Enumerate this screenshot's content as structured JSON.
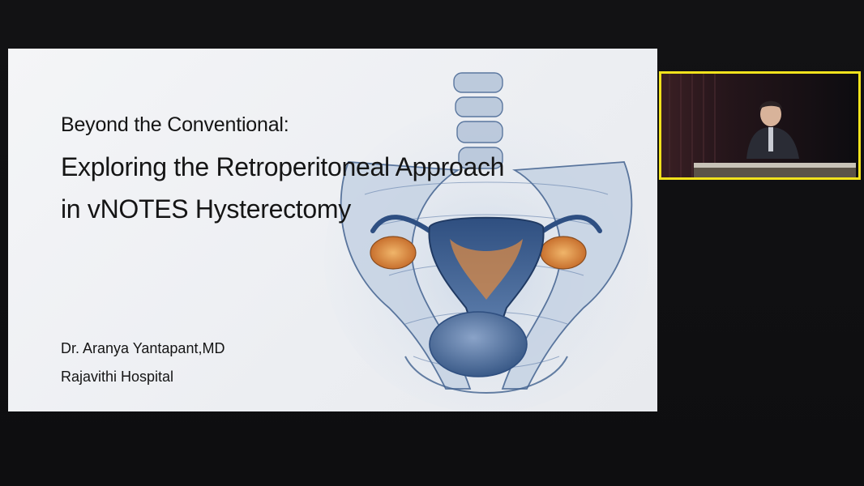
{
  "slide": {
    "subtitle": "Beyond the Conventional:",
    "title_line_1": "Exploring the Retroperitoneal Approach",
    "title_line_2": "in vNOTES Hysterectomy",
    "author": "Dr. Aranya Yantapant,MD",
    "hospital": "Rajavithi Hospital",
    "illustration": "pelvic-anatomy-illustration"
  },
  "webcam": {
    "highlight_color": "#f2e21c"
  },
  "colors": {
    "background": "#111113",
    "slide_background": "#f1f2f5",
    "text": "#151515",
    "anatomy_blue": "#3b5f91",
    "ovary_orange": "#d9833a"
  }
}
